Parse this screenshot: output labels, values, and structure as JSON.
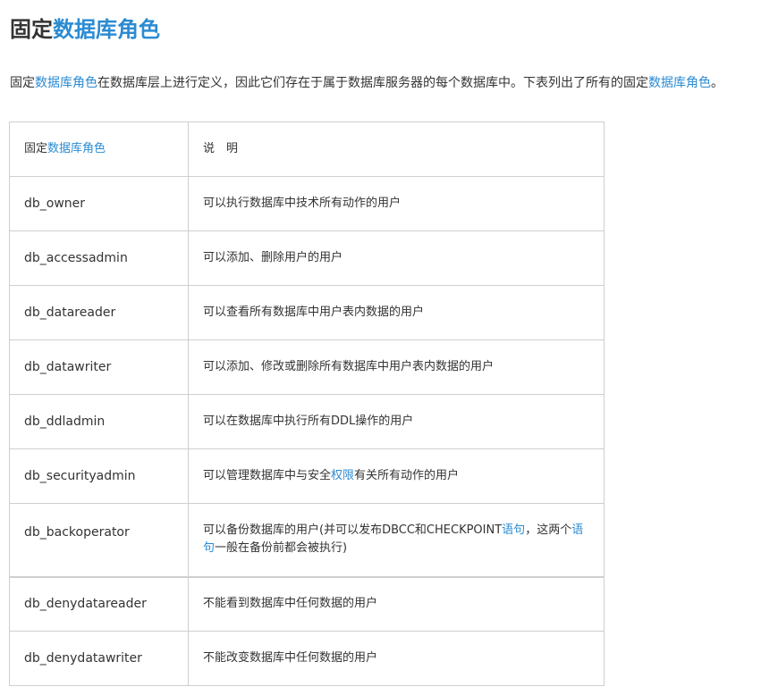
{
  "title": {
    "prefix": "固定",
    "link": "数据库角色"
  },
  "intro": {
    "t1": "固定",
    "l1": "数据库角色",
    "t2": "在数据库层上进行定义，因此它们存在于属于数据库服务器的每个数据库中。下表列出了所有的固定",
    "l2": "数据库角色",
    "t3": "。"
  },
  "table": {
    "header": {
      "col1_prefix": "固定",
      "col1_link": "数据库角色",
      "col2": "说　明"
    },
    "rows": [
      {
        "role": "db_owner",
        "desc": "可以执行数据库中技术所有动作的用户"
      },
      {
        "role": "db_accessadmin",
        "desc": "可以添加、删除用户的用户"
      },
      {
        "role": "db_datareader",
        "desc": "可以查看所有数据库中用户表内数据的用户"
      },
      {
        "role": "db_datawriter",
        "desc": "可以添加、修改或删除所有数据库中用户表内数据的用户"
      },
      {
        "role": "db_ddladmin",
        "desc": "可以在数据库中执行所有DDL操作的用户"
      },
      {
        "role": "db_securityadmin",
        "desc_a": "可以管理数据库中与安全",
        "desc_link": "权限",
        "desc_b": "有关所有动作的用户"
      },
      {
        "role": "db_backoperator",
        "desc_a": "可以备份数据库的用户(并可以发布DBCC和CHECKPOINT",
        "desc_link": "语句",
        "desc_b": "，这两个",
        "desc_link2": "语句",
        "desc_c": "一般在备份前都会被执行)"
      },
      {
        "role": "db_denydatareader",
        "desc": "不能看到数据库中任何数据的用户"
      },
      {
        "role": "db_denydatawriter",
        "desc": "不能改变数据库中任何数据的用户"
      }
    ]
  },
  "colors": {
    "link": "#2b8bd2",
    "text": "#333333",
    "border": "#cfcfcf"
  }
}
